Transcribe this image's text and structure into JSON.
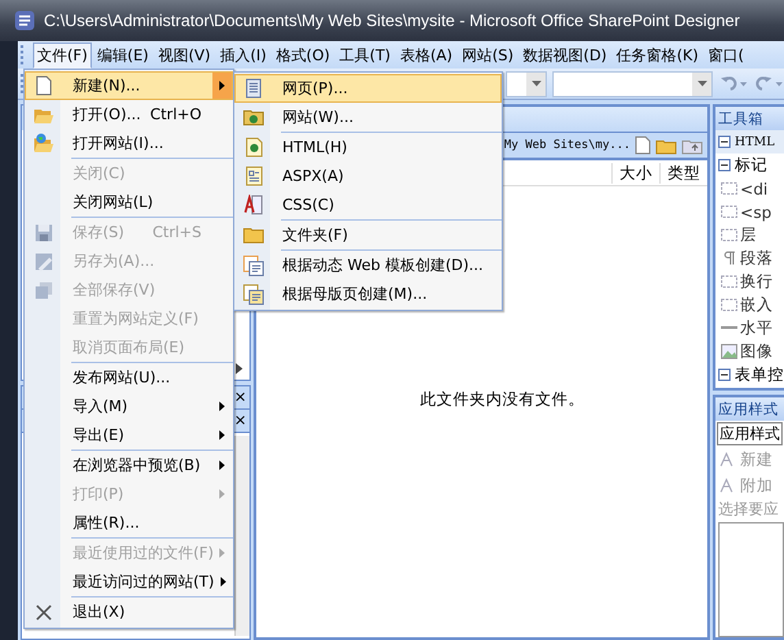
{
  "window": {
    "title": "C:\\Users\\Administrator\\Documents\\My Web Sites\\mysite - Microsoft Office SharePoint Designer"
  },
  "menubar": [
    {
      "label": "文件(F)",
      "selected": true
    },
    {
      "label": "编辑(E)",
      "selected": false
    },
    {
      "label": "视图(V)",
      "selected": false
    },
    {
      "label": "插入(I)",
      "selected": false
    },
    {
      "label": "格式(O)",
      "selected": false
    },
    {
      "label": "工具(T)",
      "selected": false
    },
    {
      "label": "表格(A)",
      "selected": false
    },
    {
      "label": "网站(S)",
      "selected": false
    },
    {
      "label": "数据视图(D)",
      "selected": false
    },
    {
      "label": "任务窗格(K)",
      "selected": false
    },
    {
      "label": "窗口(",
      "selected": false
    }
  ],
  "file_menu": [
    {
      "label": "新建(N)...",
      "selected": true,
      "disabled": false,
      "submenu": true,
      "separator_before": false
    },
    {
      "label": "打开(O)...",
      "shortcut": "Ctrl+O",
      "selected": false,
      "disabled": false,
      "submenu": false,
      "separator_before": false
    },
    {
      "label": "打开网站(I)...",
      "selected": false,
      "disabled": false,
      "submenu": false,
      "separator_before": false
    },
    {
      "label": "关闭(C)",
      "selected": false,
      "disabled": true,
      "submenu": false,
      "separator_before": true
    },
    {
      "label": "关闭网站(L)",
      "selected": false,
      "disabled": false,
      "submenu": false,
      "separator_before": false
    },
    {
      "label": "保存(S)",
      "shortcut": "Ctrl+S",
      "selected": false,
      "disabled": true,
      "submenu": false,
      "separator_before": true
    },
    {
      "label": "另存为(A)...",
      "selected": false,
      "disabled": true,
      "submenu": false,
      "separator_before": false
    },
    {
      "label": "全部保存(V)",
      "selected": false,
      "disabled": true,
      "submenu": false,
      "separator_before": false
    },
    {
      "label": "重置为网站定义(F)",
      "selected": false,
      "disabled": true,
      "submenu": false,
      "separator_before": false
    },
    {
      "label": "取消页面布局(E)",
      "selected": false,
      "disabled": true,
      "submenu": false,
      "separator_before": false
    },
    {
      "label": "发布网站(U)...",
      "selected": false,
      "disabled": false,
      "submenu": false,
      "separator_before": true
    },
    {
      "label": "导入(M)",
      "selected": false,
      "disabled": false,
      "submenu": true,
      "separator_before": false
    },
    {
      "label": "导出(E)",
      "selected": false,
      "disabled": false,
      "submenu": true,
      "separator_before": false
    },
    {
      "label": "在浏览器中预览(B)",
      "selected": false,
      "disabled": false,
      "submenu": true,
      "separator_before": true
    },
    {
      "label": "打印(P)",
      "selected": false,
      "disabled": true,
      "submenu": true,
      "separator_before": false
    },
    {
      "label": "属性(R)...",
      "selected": false,
      "disabled": false,
      "submenu": false,
      "separator_before": false
    },
    {
      "label": "最近使用过的文件(F)",
      "selected": false,
      "disabled": true,
      "submenu": true,
      "separator_before": true
    },
    {
      "label": "最近访问过的网站(T)",
      "selected": false,
      "disabled": false,
      "submenu": true,
      "separator_before": false
    },
    {
      "label": "退出(X)",
      "selected": false,
      "disabled": false,
      "submenu": false,
      "separator_before": true
    }
  ],
  "new_submenu": [
    {
      "label": "网页(P)...",
      "selected": true,
      "separator_before": false
    },
    {
      "label": "网站(W)...",
      "selected": false,
      "separator_before": false
    },
    {
      "label": "HTML(H)",
      "selected": false,
      "separator_before": true
    },
    {
      "label": "ASPX(A)",
      "selected": false,
      "separator_before": false
    },
    {
      "label": "CSS(C)",
      "selected": false,
      "separator_before": false
    },
    {
      "label": "文件夹(F)",
      "selected": false,
      "separator_before": true
    },
    {
      "label": "根据动态 Web 模板创建(D)...",
      "selected": false,
      "separator_before": true
    },
    {
      "label": "根据母版页创建(M)...",
      "selected": false,
      "separator_before": false
    }
  ],
  "left_panel": {
    "close_buttons": [
      "×",
      "×"
    ]
  },
  "folder_panel": {
    "path": "My Web Sites\\my...",
    "columns": [
      "大小",
      "类型"
    ],
    "empty_message": "此文件夹内没有文件。"
  },
  "toolbox": {
    "title": "工具箱",
    "sections": [
      {
        "label": "HTML",
        "expanded": true
      },
      {
        "label": "标记",
        "expanded": true
      }
    ],
    "items": [
      "<di",
      "<sp",
      "层",
      "段落",
      "换行",
      "嵌入",
      "水平",
      "图像"
    ],
    "form_section": {
      "label": "表单控",
      "expanded": true
    }
  },
  "styles_panel": {
    "title": "应用样式",
    "tab": "应用样式",
    "actions": [
      "新建",
      "附加"
    ],
    "hint": "选择要应"
  }
}
